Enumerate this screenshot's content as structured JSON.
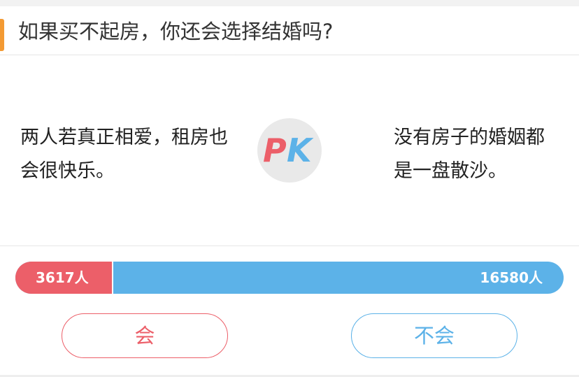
{
  "question": {
    "title": "如果买不起房，你还会选择结婚吗?"
  },
  "pk": {
    "left_opinion": "两人若真正相爱，租房也会很快乐。",
    "right_opinion": "没有房子的婚姻都是一盘散沙。",
    "badge_left": "P",
    "badge_right": "K"
  },
  "votes": {
    "left_count": 3617,
    "right_count": 16580,
    "left_label": "3617人",
    "right_label": "16580人"
  },
  "choices": {
    "yes_label": "会",
    "no_label": "不会"
  },
  "colors": {
    "accent_orange": "#f39a33",
    "pro_red": "#ec5f69",
    "con_blue": "#5cb2e8",
    "badge_bg": "#e9e9e9"
  }
}
